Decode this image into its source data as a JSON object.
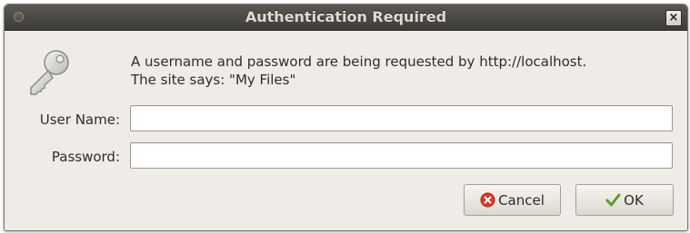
{
  "window": {
    "title": "Authentication Required",
    "close_glyph": "×"
  },
  "icons": {
    "title_circle": "window-menu-icon",
    "key": "key-icon",
    "cancel": "cancel-icon",
    "ok": "ok-checkmark-icon"
  },
  "message": {
    "line1": "A username and password are being requested by http://localhost.",
    "line2": "The site says: \"My Files\""
  },
  "form": {
    "username_label": "User Name:",
    "username_value": "",
    "password_label": "Password:",
    "password_value": ""
  },
  "buttons": {
    "cancel_label": "Cancel",
    "ok_label": "OK"
  },
  "colors": {
    "titlebar": "#3c3b37",
    "title_text": "#dfdbd2",
    "dialog_bg": "#efebe7",
    "cancel_red": "#d63b2a",
    "ok_green": "#5aa02c"
  }
}
